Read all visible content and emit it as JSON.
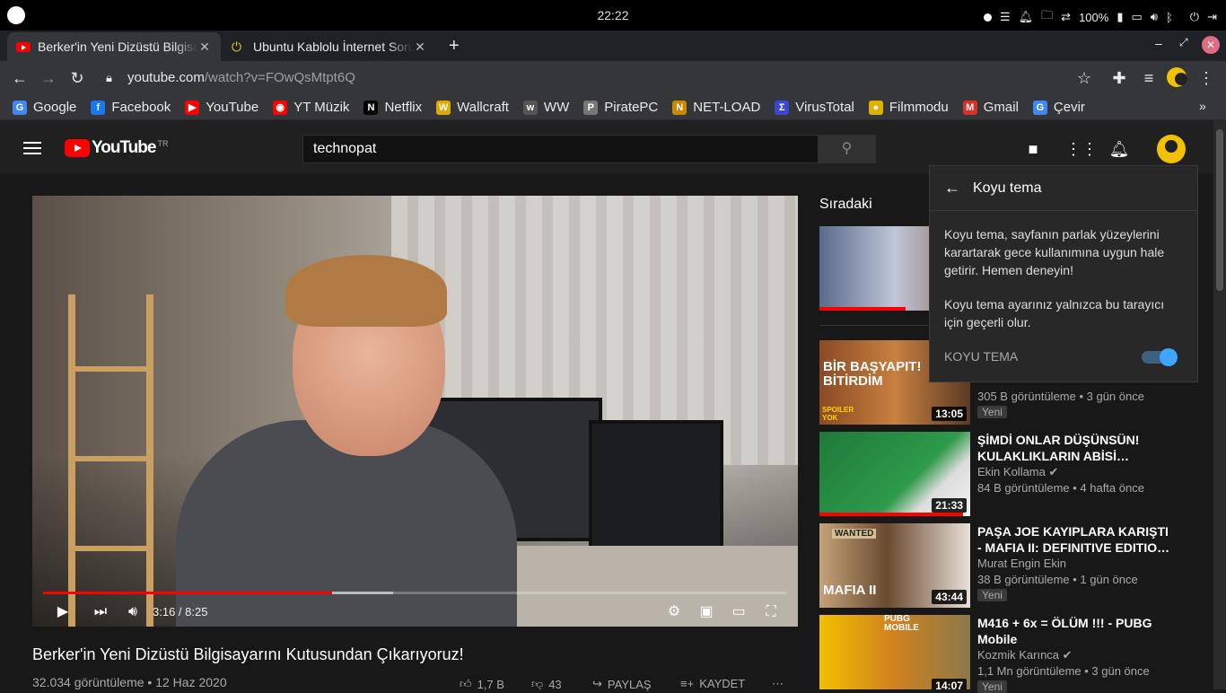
{
  "system": {
    "clock": "22:22",
    "battery": "100%"
  },
  "tabs": [
    {
      "title": "Berker'in Yeni Dizüstü Bilgisayarını Kutusundan Çıkarıyoruz!",
      "close": "✕"
    },
    {
      "title": "Ubuntu Kablolu İnternet Sorunu",
      "close": "✕"
    }
  ],
  "toolbar": {
    "url_host": "youtube.com",
    "url_path": "/watch?v=FOwQsMtpt6Q"
  },
  "bookmarks": [
    {
      "label": "Google",
      "color": "#4285f4",
      "glyph": "G"
    },
    {
      "label": "Facebook",
      "color": "#1877f2",
      "glyph": "f"
    },
    {
      "label": "YouTube",
      "color": "#ff0000",
      "glyph": "▶"
    },
    {
      "label": "YT Müzik",
      "color": "#ff0000",
      "glyph": "◉"
    },
    {
      "label": "Netflix",
      "color": "#000000",
      "glyph": "N"
    },
    {
      "label": "Wallcraft",
      "color": "#e0a800",
      "glyph": "W"
    },
    {
      "label": "WW",
      "color": "#555555",
      "glyph": "w"
    },
    {
      "label": "PiratePC",
      "color": "#777777",
      "glyph": "P"
    },
    {
      "label": "NET-LOAD",
      "color": "#cc8800",
      "glyph": "N"
    },
    {
      "label": "VirusTotal",
      "color": "#3948d4",
      "glyph": "Σ"
    },
    {
      "label": "Filmmodu",
      "color": "#e0b000",
      "glyph": "●"
    },
    {
      "label": "Gmail",
      "color": "#d93025",
      "glyph": "M"
    },
    {
      "label": "Çevir",
      "color": "#4285f4",
      "glyph": "G"
    }
  ],
  "youtube": {
    "logo_text": "YouTube",
    "region": "TR",
    "search_value": "technopat"
  },
  "video": {
    "title": "Berker'in Yeni Dizüstü Bilgisayarını Kutusundan Çıkarıyoruz!",
    "meta": "32.034 görüntüleme • 12 Haz 2020",
    "time": "3:16 / 8:25",
    "played_fraction": 0.388,
    "buffered_fraction": 0.47,
    "likes": "1,7 B",
    "dislikes": "43",
    "share": "PAYLAŞ",
    "save": "KAYDET"
  },
  "sidebar": {
    "title": "Sıradaki",
    "items": [
      {
        "title": "",
        "channel": "",
        "meta": "",
        "duration": "",
        "badge": "",
        "watched": 0.57
      },
      {
        "title": "",
        "channel": "",
        "meta": "305 B görüntüleme • 3 gün önce",
        "duration": "13:05",
        "badge": "Yeni",
        "thumb_text": "BİR BAŞYAPIT! BİTİRDİM",
        "thumb_sub": "SPOILER YOK"
      },
      {
        "title": "ŞİMDİ ONLAR DÜŞÜNSÜN! KULAKLIKLARIN ABİSİ…",
        "channel": "Ekin Kollama",
        "meta": "84 B görüntüleme • 4 hafta önce",
        "duration": "21:33",
        "badge": "",
        "watched": 0.95
      },
      {
        "title": "PAŞA JOE KAYIPLARA KARIŞTI - MAFIA II: DEFINITIVE EDITIO…",
        "channel": "Murat Engin Ekin",
        "meta": "38 B görüntüleme • 1 gün önce",
        "duration": "43:44",
        "badge": "Yeni",
        "thumb_text": "WANTED",
        "thumb_sub": "MAFIA II"
      },
      {
        "title": "M416 + 6x = ÖLÜM !!! - PUBG Mobile",
        "channel": "Kozmik Karınca",
        "meta": "1,1 Mn görüntüleme • 3 gün önce",
        "duration": "14:07",
        "badge": "Yeni",
        "thumb_text": "PUBG MOBILE"
      }
    ]
  },
  "popup": {
    "title": "Koyu tema",
    "p1": "Koyu tema, sayfanın parlak yüzeylerini karartarak gece kullanımına uygun hale getirir. Hemen deneyin!",
    "p2": "Koyu tema ayarınız yalnızca bu tarayıcı için geçerli olur.",
    "toggle_label": "KOYU TEMA",
    "toggle_on": true
  }
}
